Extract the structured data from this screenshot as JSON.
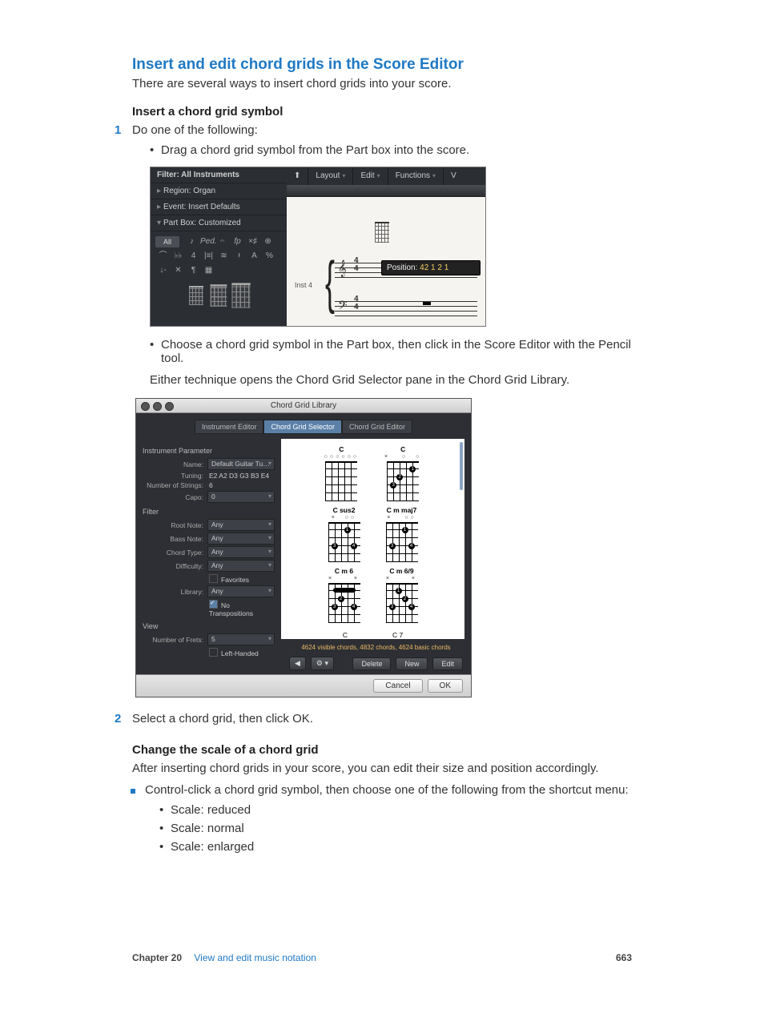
{
  "heading": "Insert and edit chord grids in the Score Editor",
  "intro": "There are several ways to insert chord grids into your score.",
  "sub1": "Insert a chord grid symbol",
  "step1": {
    "num": "1",
    "text": "Do one of the following:"
  },
  "drag_bullet": "Drag a chord grid symbol from the Part box into the score.",
  "choose_bullet": "Choose a chord grid symbol in the Part box, then click in the Score Editor with the Pencil tool.",
  "either": "Either technique opens the Chord Grid Selector pane in the Chord Grid Library.",
  "step2": {
    "num": "2",
    "text": "Select a chord grid, then click OK."
  },
  "sub2": "Change the scale of a chord grid",
  "sub2_desc": "After inserting chord grids in your score, you can edit their size and position accordingly.",
  "control_click": "Control-click a chord grid symbol, then choose one of the following from the shortcut menu:",
  "scales": [
    "Scale: reduced",
    "Scale: normal",
    "Scale: enlarged"
  ],
  "shot1": {
    "filter": "Filter: All Instruments",
    "region": "Region: Organ",
    "event": "Event: Insert Defaults",
    "partbox": "Part Box: Customized",
    "all": "All",
    "toolbar": {
      "layout": "Layout",
      "edit": "Edit",
      "functions": "Functions",
      "v": "V"
    },
    "inst": "Inst 4",
    "tip_label": "Position:",
    "tip_value": "42 1 2 1"
  },
  "shot2": {
    "title": "Chord Grid Library",
    "tabs": {
      "inst": "Instrument Editor",
      "sel": "Chord Grid Selector",
      "edit": "Chord Grid Editor"
    },
    "params_head": "Instrument Parameter",
    "name_lbl": "Name:",
    "name_val": "Default Guitar Tu…",
    "tuning_lbl": "Tuning:",
    "tuning_val": "E2 A2 D3 G3 B3 E4",
    "strings_lbl": "Number of Strings:",
    "strings_val": "6",
    "capo_lbl": "Capo:",
    "capo_val": "0",
    "filter_head": "Filter",
    "root_lbl": "Root Note:",
    "root_val": "Any",
    "bass_lbl": "Bass Note:",
    "bass_val": "Any",
    "ctype_lbl": "Chord Type:",
    "ctype_val": "Any",
    "diff_lbl": "Difficulty:",
    "diff_val": "Any",
    "fav": "Favorites",
    "lib_lbl": "Library:",
    "lib_val": "Any",
    "notrans": "No Transpositions",
    "view_head": "View",
    "frets_lbl": "Number of Frets:",
    "frets_val": "5",
    "lefth": "Left-Handed",
    "chords": {
      "c": "C",
      "csus2": "C sus2",
      "cmmaj7": "C m maj7",
      "cm6": "C m 6",
      "cm69": "C m 6/9",
      "c_more": "C",
      "c7": "C 7"
    },
    "status": "4624 visible chords, 4832 chords, 4624 basic chords",
    "play": "◀",
    "gear": "⚙ ▾",
    "delete": "Delete",
    "new": "New",
    "editbtn": "Edit",
    "cancel": "Cancel",
    "ok": "OK"
  },
  "footer": {
    "chapter": "Chapter  20",
    "title": "View and edit music notation",
    "page": "663"
  }
}
